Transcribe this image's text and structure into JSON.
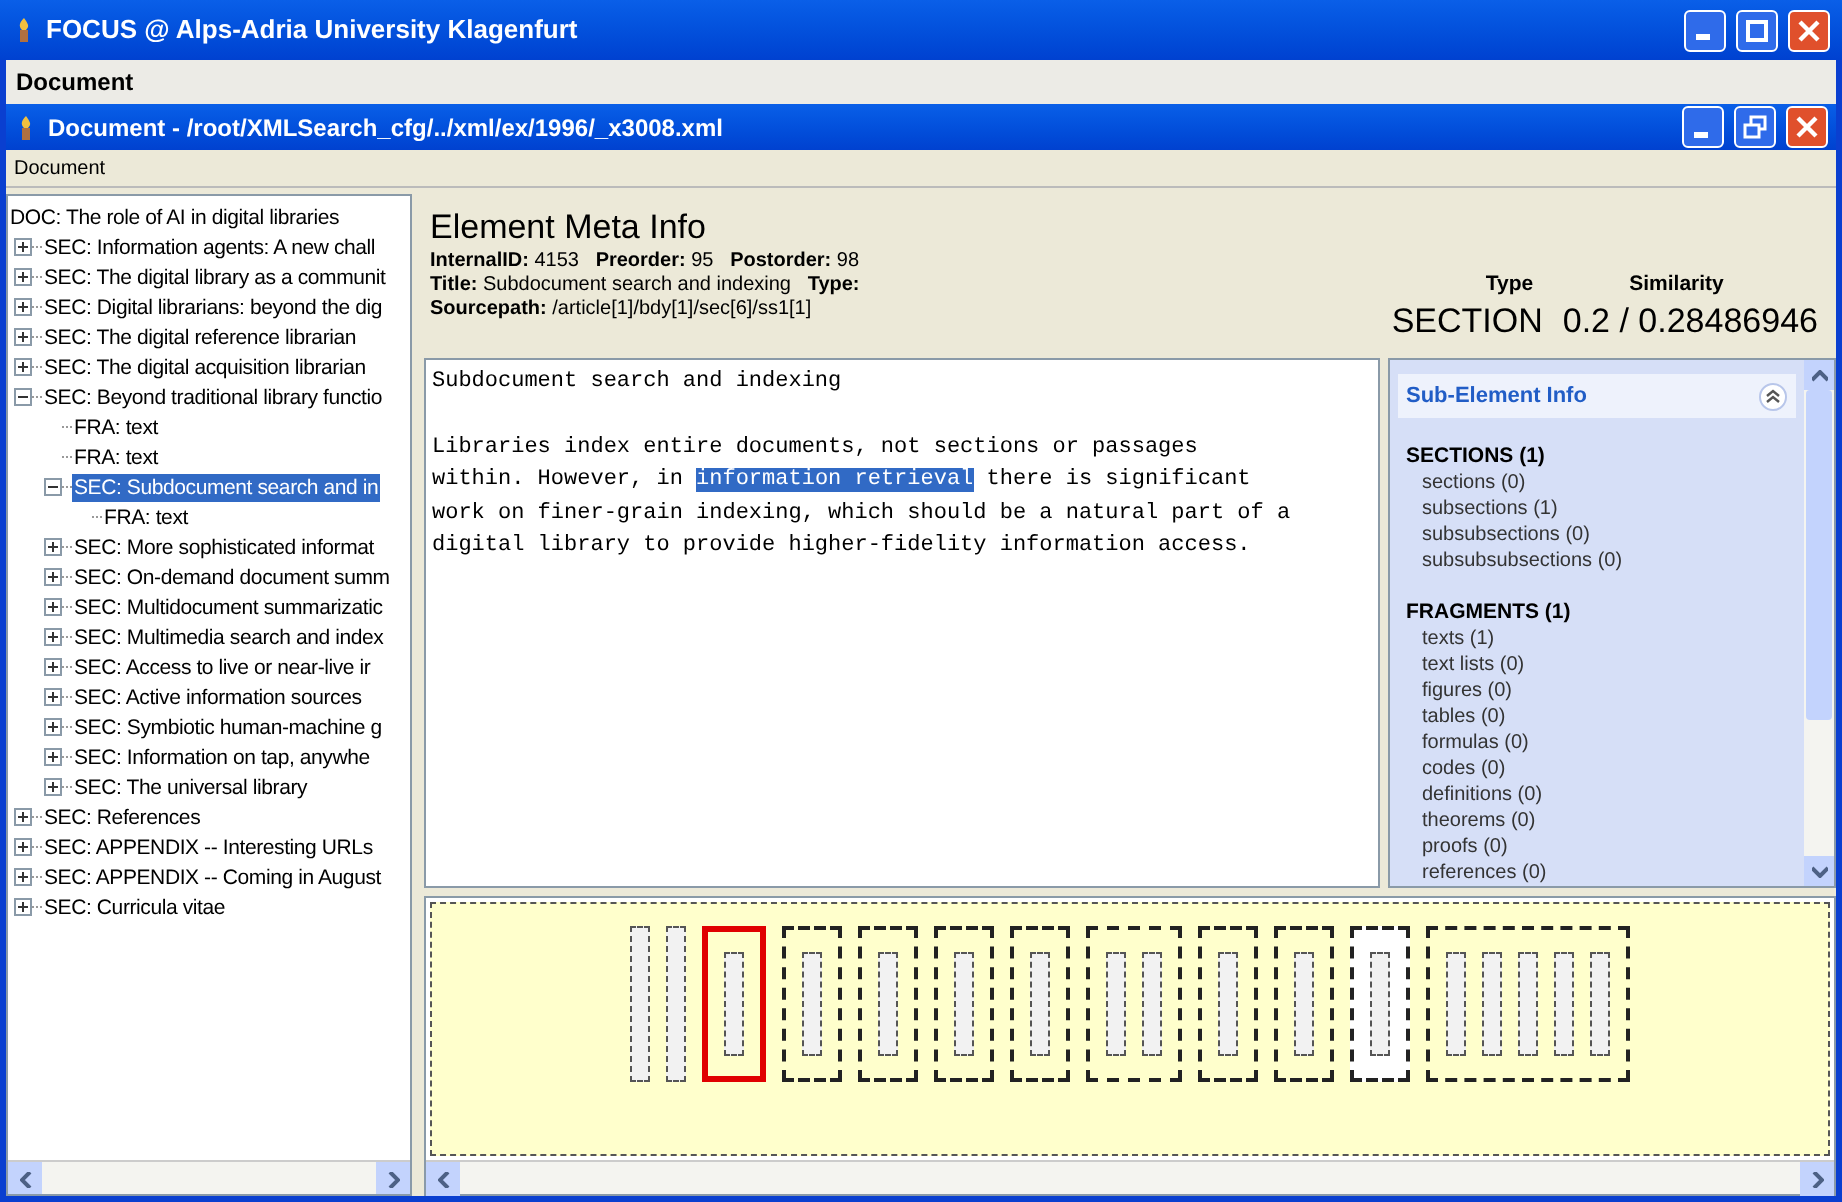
{
  "window": {
    "title": "FOCUS @ Alps-Adria University Klagenfurt"
  },
  "menu": [
    "Document"
  ],
  "document_window": {
    "title": "Document - /root/XMLSearch_cfg/../xml/ex/1996/_x3008.xml",
    "menu": [
      "Document"
    ]
  },
  "tree": {
    "label": "DOC: The role of AI in digital libraries",
    "selected": false,
    "children": [
      {
        "label": "SEC: Information agents: A new chall",
        "expanded": false,
        "selected": false
      },
      {
        "label": "SEC: The digital library as a communit",
        "expanded": false,
        "selected": false
      },
      {
        "label": "SEC: Digital librarians: beyond the dig",
        "expanded": false,
        "selected": false
      },
      {
        "label": "SEC: The digital reference librarian",
        "expanded": false,
        "selected": false
      },
      {
        "label": "SEC: The digital acquisition librarian",
        "expanded": false,
        "selected": false
      },
      {
        "label": "SEC: Beyond traditional library functio",
        "expanded": true,
        "selected": false,
        "children": [
          {
            "label": "FRA: text",
            "selected": false
          },
          {
            "label": "FRA: text",
            "selected": false
          },
          {
            "label": "SEC: Subdocument search and in",
            "expanded": true,
            "selected": true,
            "children": [
              {
                "label": "FRA: text",
                "selected": false
              }
            ]
          },
          {
            "label": "SEC: More sophisticated informat",
            "expanded": false,
            "selected": false
          },
          {
            "label": "SEC: On-demand document summ",
            "expanded": false,
            "selected": false
          },
          {
            "label": "SEC: Multidocument summarizatic",
            "expanded": false,
            "selected": false
          },
          {
            "label": "SEC: Multimedia search and index",
            "expanded": false,
            "selected": false
          },
          {
            "label": "SEC: Access to live or near-live ir",
            "expanded": false,
            "selected": false
          },
          {
            "label": "SEC: Active information sources",
            "expanded": false,
            "selected": false
          },
          {
            "label": "SEC: Symbiotic human-machine g",
            "expanded": false,
            "selected": false
          },
          {
            "label": "SEC: Information on tap, anywhe",
            "expanded": false,
            "selected": false
          },
          {
            "label": "SEC: The universal library",
            "expanded": false,
            "selected": false
          }
        ]
      },
      {
        "label": "SEC: References",
        "expanded": false,
        "selected": false
      },
      {
        "label": "SEC: APPENDIX -- Interesting URLs",
        "expanded": false,
        "selected": false
      },
      {
        "label": "SEC: APPENDIX -- Coming in August",
        "expanded": false,
        "selected": false
      },
      {
        "label": "SEC: Curricula vitae",
        "expanded": false,
        "selected": false
      }
    ]
  },
  "meta": {
    "heading": "Element Meta Info",
    "lines": [
      "**InternalID:** 4153   **Preorder:** 95   **Postorder:** 98",
      "**Title:** Subdocument search and indexing   **Type:**",
      "**Sourcepath:** /article[1]/bdy[1]/sec[6]/ss1[1]"
    ],
    "type_label": "Type",
    "similarity_label": "Similarity",
    "type_value": "SECTION",
    "similarity_value": "0.2 / 0.28486946"
  },
  "content": {
    "title": "Subdocument search and indexing",
    "lines": [
      [
        {
          "text": "Libraries index entire documents, not sections or passages",
          "selected": false
        }
      ],
      [
        {
          "text": "within. However, in ",
          "selected": false
        },
        {
          "text": "information retrieval",
          "selected": true
        },
        {
          "text": " there is significant",
          "selected": false
        }
      ],
      [
        {
          "text": "work on finer-grain indexing, which should be a natural part of a",
          "selected": false
        }
      ],
      [
        {
          "text": "digital library to provide higher-fidelity information access.",
          "selected": false
        }
      ]
    ]
  },
  "sub_element_info": {
    "title": "Sub-Element Info",
    "expanded": true,
    "groups": [
      {
        "heading": "SECTIONS (1)",
        "items": [
          "sections (0)",
          "subsections (1)",
          "subsubsections (0)",
          "subsubsubsections (0)"
        ]
      },
      {
        "heading": "FRAGMENTS (1)",
        "items": [
          "texts (1)",
          "text lists (0)",
          "figures (0)",
          "tables (0)",
          "formulas (0)",
          "codes (0)",
          "definitions (0)",
          "theorems (0)",
          "proofs (0)",
          "references (0)"
        ]
      }
    ]
  },
  "structure": [
    {
      "kind": "leaf",
      "selected": false
    },
    {
      "kind": "leaf",
      "selected": false
    },
    {
      "kind": "group",
      "selected": true,
      "light": false,
      "bars": [
        {
          "kind": "bar"
        }
      ]
    },
    {
      "kind": "group",
      "selected": false,
      "light": false,
      "bars": [
        {
          "kind": "bar"
        }
      ]
    },
    {
      "kind": "group",
      "selected": false,
      "light": false,
      "bars": [
        {
          "kind": "bar"
        }
      ]
    },
    {
      "kind": "group",
      "selected": false,
      "light": false,
      "bars": [
        {
          "kind": "bar"
        }
      ]
    },
    {
      "kind": "group",
      "selected": false,
      "light": false,
      "bars": [
        {
          "kind": "bar"
        }
      ]
    },
    {
      "kind": "group",
      "selected": false,
      "light": false,
      "bars": [
        {
          "kind": "bar"
        },
        {
          "kind": "bar"
        }
      ]
    },
    {
      "kind": "group",
      "selected": false,
      "light": false,
      "bars": [
        {
          "kind": "bar"
        }
      ]
    },
    {
      "kind": "group",
      "selected": false,
      "light": false,
      "bars": [
        {
          "kind": "bar"
        }
      ]
    },
    {
      "kind": "group",
      "selected": false,
      "light": true,
      "bars": [
        {
          "kind": "bar"
        }
      ]
    },
    {
      "kind": "group",
      "selected": false,
      "light": false,
      "bars": [
        {
          "kind": "bar"
        },
        {
          "kind": "bar"
        },
        {
          "kind": "bar"
        },
        {
          "kind": "bar"
        },
        {
          "kind": "bar"
        }
      ]
    }
  ]
}
